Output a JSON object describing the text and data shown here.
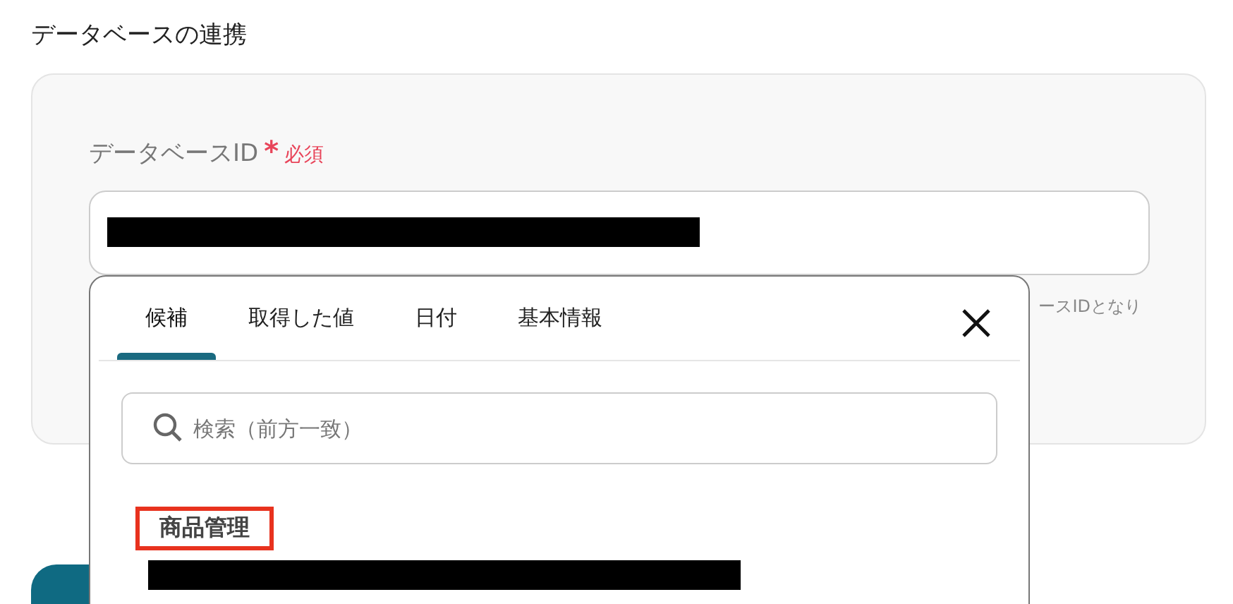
{
  "section_title": "データベースの連携",
  "field": {
    "label": "データベースID",
    "required_mark": "*",
    "required_label": "必須",
    "value_redacted": true,
    "hint": "ースIDとなり"
  },
  "picker": {
    "tabs": [
      {
        "label": "候補",
        "selected": true
      },
      {
        "label": "取得した値",
        "selected": false
      },
      {
        "label": "日付",
        "selected": false
      },
      {
        "label": "基本情報",
        "selected": false
      }
    ],
    "search": {
      "placeholder": "検索（前方一致）"
    },
    "items": [
      {
        "title": "商品管理",
        "highlighted": true,
        "value_redacted": true
      }
    ]
  }
}
